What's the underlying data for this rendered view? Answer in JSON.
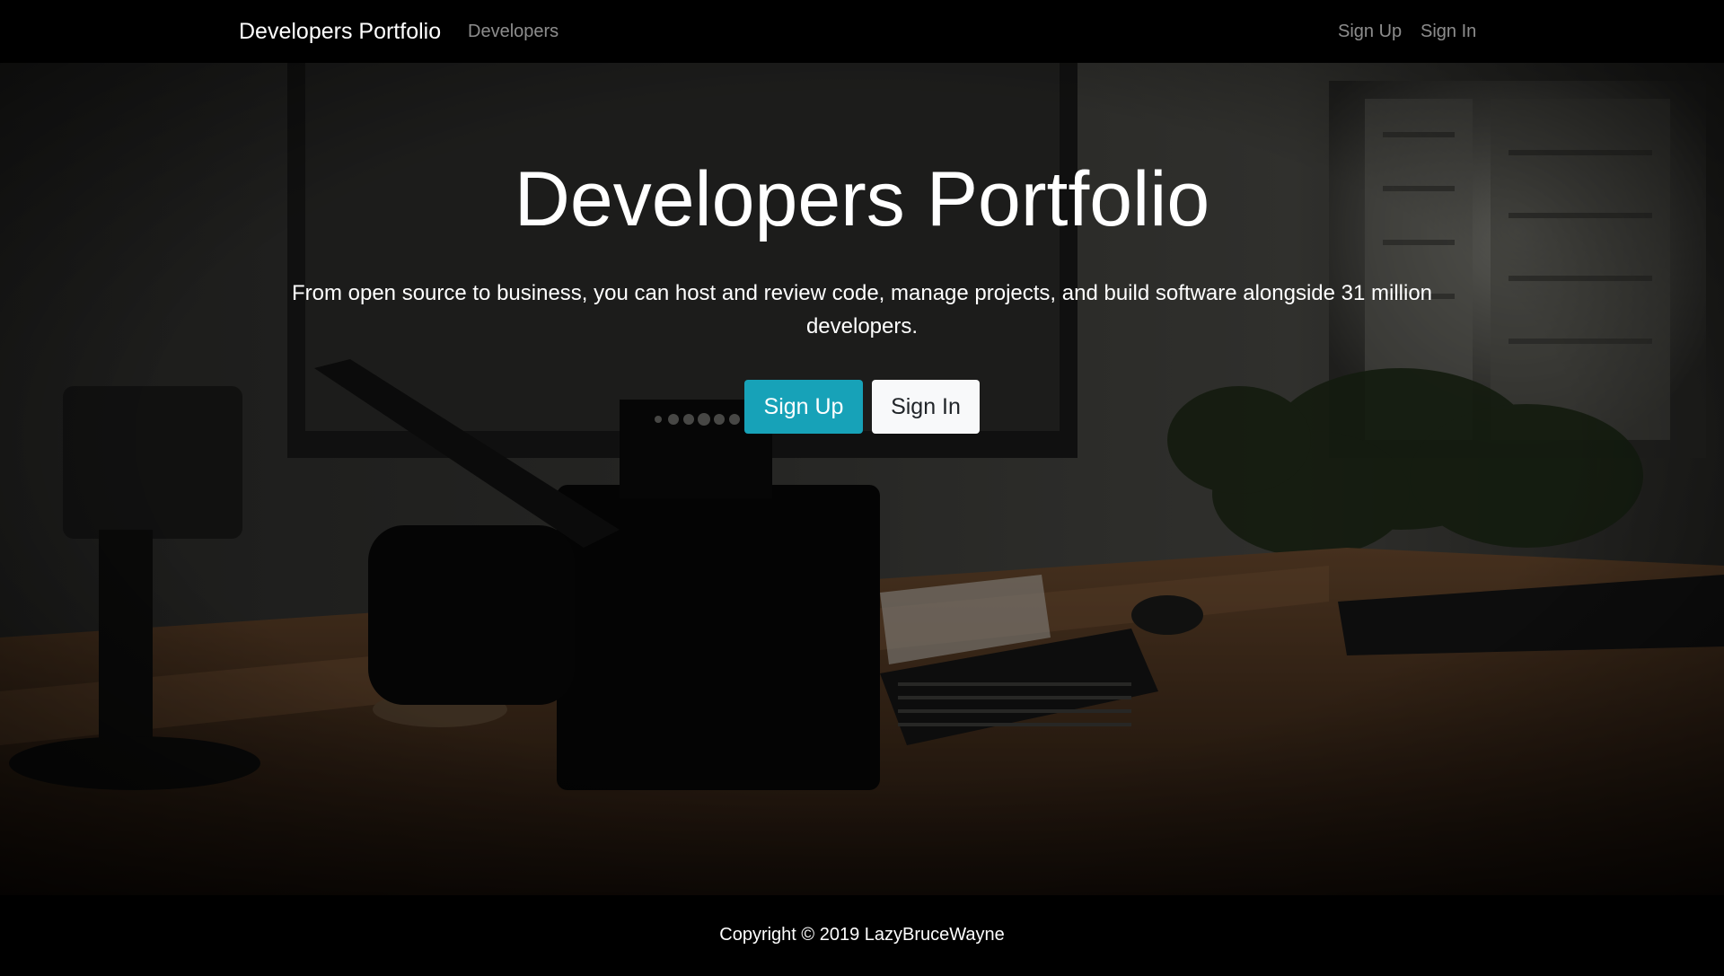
{
  "navbar": {
    "brand": "Developers Portfolio",
    "links": {
      "developers": "Developers",
      "signup": "Sign Up",
      "signin": "Sign In"
    }
  },
  "hero": {
    "title": "Developers Portfolio",
    "lead": "From open source to business, you can host and review code, manage projects, and build software alongside 31 million developers.",
    "buttons": {
      "signup": "Sign Up",
      "signin": "Sign In"
    },
    "background": "dark-desk-workspace-photo"
  },
  "footer": {
    "copyright": "Copyright © 2019 LazyBruceWayne"
  },
  "colors": {
    "navbar_bg": "#000000",
    "signup_button": "#17a2b8",
    "signin_button": "#f8f9fa",
    "nav_link": "rgba(255,255,255,0.55)"
  }
}
